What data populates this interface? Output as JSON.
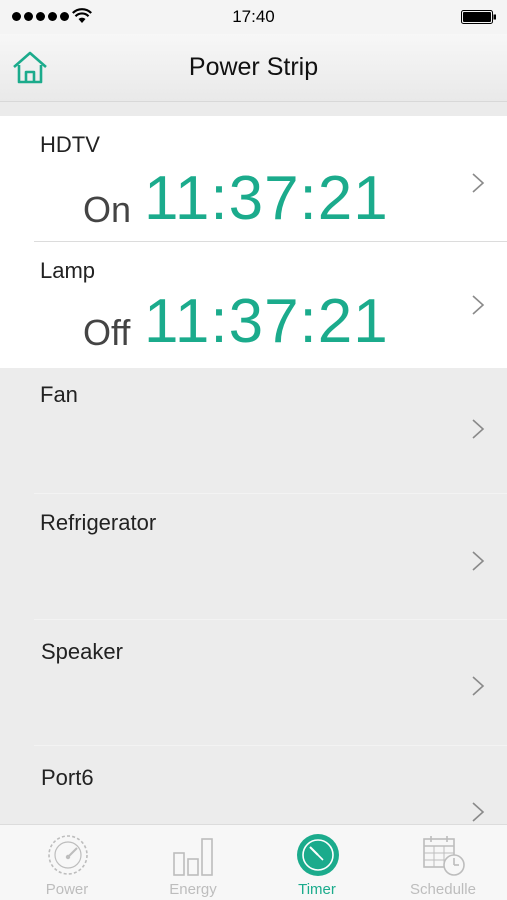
{
  "status": {
    "time": "17:40"
  },
  "nav": {
    "title": "Power Strip"
  },
  "outlets": [
    {
      "name": "HDTV",
      "state": "On",
      "time": "11:37:21"
    },
    {
      "name": "Lamp",
      "state": "Off",
      "time": "11:37:21"
    },
    {
      "name": "Fan"
    },
    {
      "name": "Refrigerator"
    },
    {
      "name": "Speaker"
    },
    {
      "name": "Port6"
    }
  ],
  "tabs": [
    {
      "label": "Power",
      "icon": "gauge-icon"
    },
    {
      "label": "Energy",
      "icon": "bar-chart-icon"
    },
    {
      "label": "Timer",
      "icon": "timer-icon",
      "active": true
    },
    {
      "label": "Schedulle",
      "icon": "calendar-clock-icon"
    }
  ],
  "colors": {
    "accent": "#1bab8c",
    "inactive": "#bdbdbd"
  }
}
